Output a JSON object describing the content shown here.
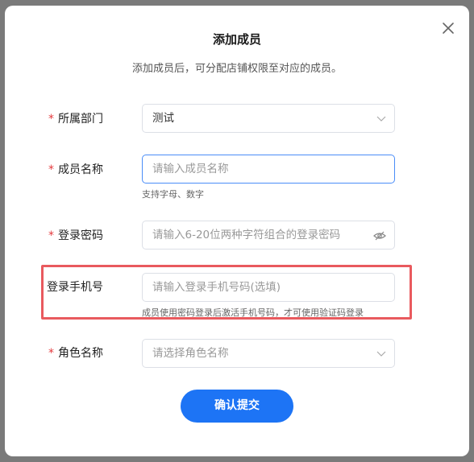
{
  "dialog": {
    "title": "添加成员",
    "subtitle": "添加成员后，可分配店铺权限至对应的成员。"
  },
  "form": {
    "department": {
      "label": "所属部门",
      "required": true,
      "value": "测试"
    },
    "member_name": {
      "label": "成员名称",
      "required": true,
      "placeholder": "请输入成员名称",
      "hint": "支持字母、数字"
    },
    "password": {
      "label": "登录密码",
      "required": true,
      "placeholder": "请输入6-20位两种字符组合的登录密码"
    },
    "phone": {
      "label": "登录手机号",
      "required": false,
      "placeholder": "请输入登录手机号码(选填)",
      "hint": "成员使用密码登录后激活手机号码，才可使用验证码登录"
    },
    "role": {
      "label": "角色名称",
      "required": true,
      "placeholder": "请选择角色名称"
    }
  },
  "required_mark": "*",
  "submit_label": "确认提交",
  "colors": {
    "primary": "#1d74f5",
    "required": "#e4393c",
    "highlight": "#e95a5e",
    "focus_border": "#4a8df8"
  },
  "icons": [
    "close-icon",
    "chevron-down-icon",
    "eye-off-icon"
  ]
}
